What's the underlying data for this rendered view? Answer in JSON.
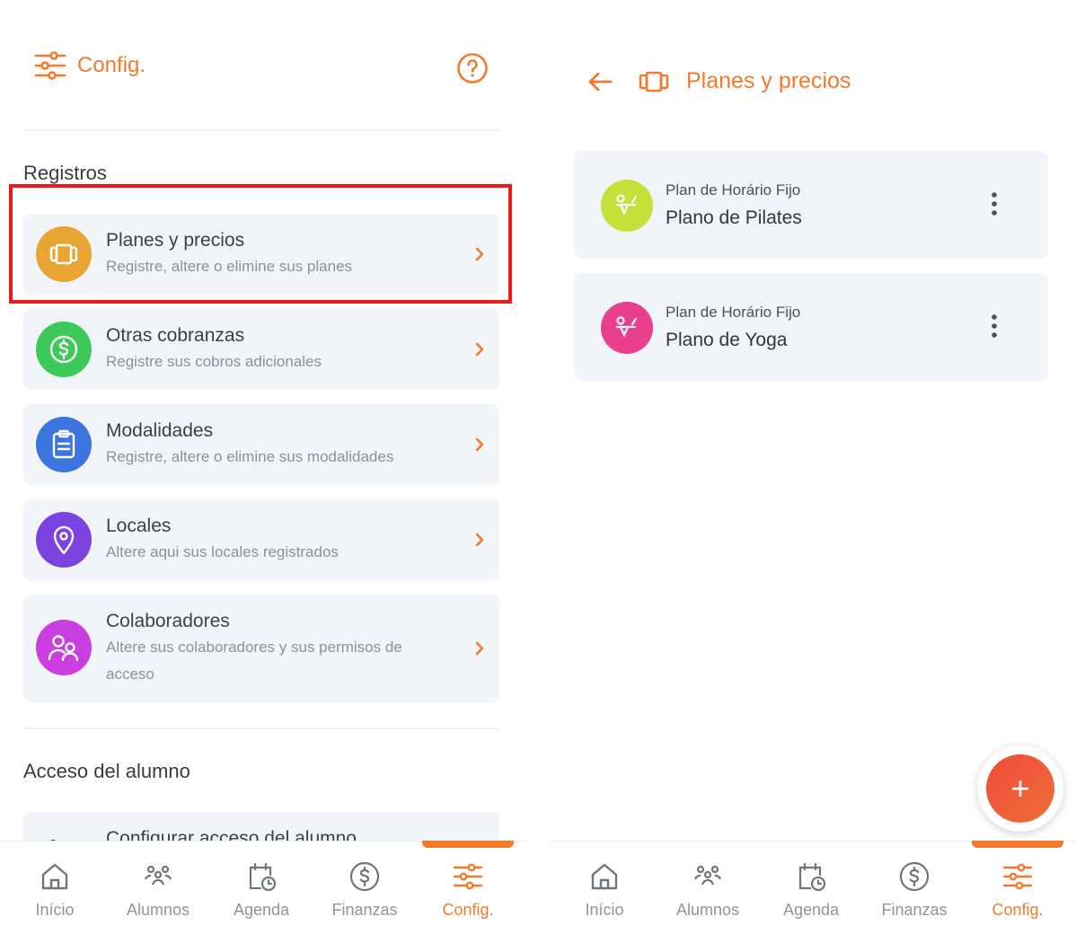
{
  "left": {
    "header": {
      "title": "Config."
    },
    "section_registros": "Registros",
    "cards": [
      {
        "title": "Planes y precios",
        "subtitle": "Registre, altere o elimine sus planes",
        "color": "#e9a531",
        "icon": "watch-band-icon"
      },
      {
        "title": "Otras cobranzas",
        "subtitle": "Registre sus cobros adicionales",
        "color": "#3cc95a",
        "icon": "dollar-coin-icon"
      },
      {
        "title": "Modalidades",
        "subtitle": "Registre, altere o elimine sus modalidades",
        "color": "#3d75e0",
        "icon": "clipboard-icon"
      },
      {
        "title": "Locales",
        "subtitle": "Altere aqui sus locales registrados",
        "color": "#7b43e0",
        "icon": "location-pin-icon"
      },
      {
        "title": "Colaboradores",
        "subtitle": "Altere sus colaboradores y sus permisos de",
        "subtitle2": "acceso",
        "color": "#c93fe0",
        "icon": "people-icon"
      }
    ],
    "section_acceso": "Acceso del alumno",
    "partial_card_title": "Configurar acceso del alumno"
  },
  "right": {
    "header": {
      "title": "Planes y precios"
    },
    "plans": [
      {
        "type": "Plan de Horário Fijo",
        "name": "Plano de Pilates",
        "color": "#c6e03a"
      },
      {
        "type": "Plan de Horário Fijo",
        "name": "Plano de Yoga",
        "color": "#ea3f8c"
      }
    ],
    "fab_label": "+"
  },
  "nav": {
    "items": [
      "Início",
      "Alumnos",
      "Agenda",
      "Finanzas",
      "Config."
    ],
    "active": "Config."
  },
  "colors": {
    "accent": "#f47a2b",
    "highlight": "#ea1b1b",
    "card_bg": "#f1f4f9"
  }
}
